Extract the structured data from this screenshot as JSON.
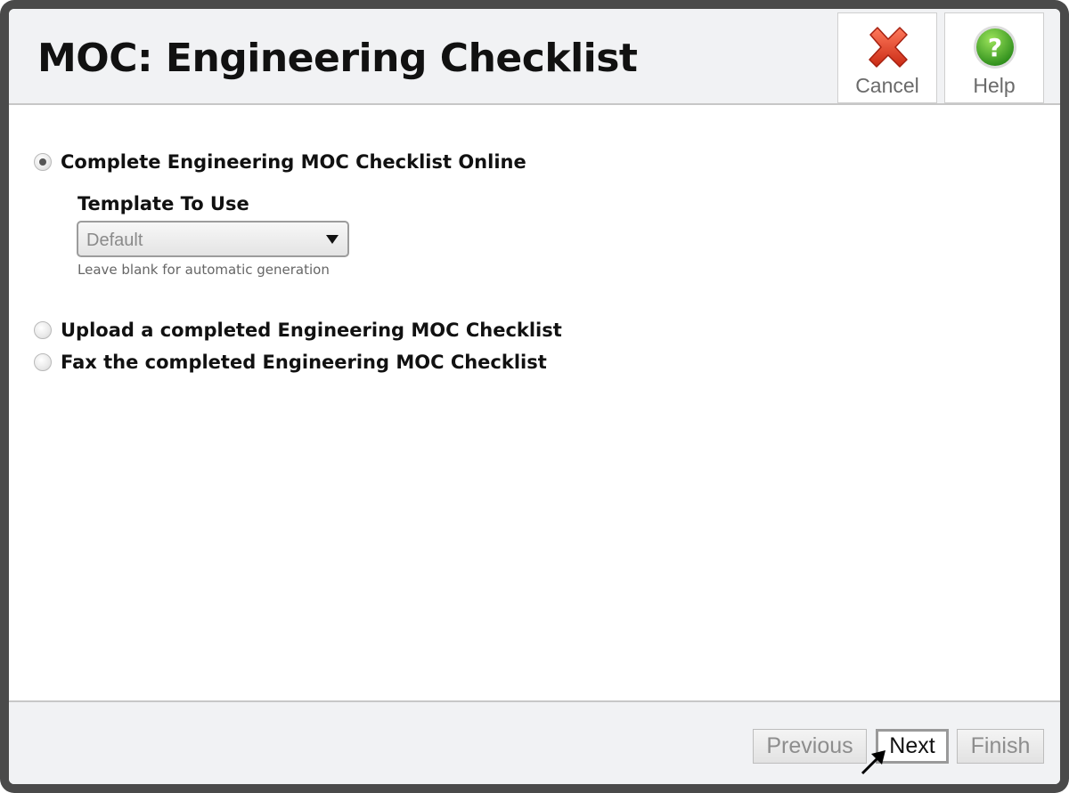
{
  "dialog": {
    "title": "MOC: Engineering Checklist"
  },
  "header_buttons": {
    "cancel_label": "Cancel",
    "cancel_icon": "red-x-icon",
    "help_label": "Help",
    "help_icon": "green-question-icon"
  },
  "options": [
    {
      "label": "Complete Engineering MOC Checklist Online",
      "selected": true
    },
    {
      "label": "Upload a completed Engineering MOC Checklist",
      "selected": false
    },
    {
      "label": "Fax the completed Engineering MOC Checklist",
      "selected": false
    }
  ],
  "template": {
    "label": "Template To Use",
    "selected_value": "Default",
    "hint": "Leave blank for automatic generation"
  },
  "footer": {
    "previous_label": "Previous",
    "next_label": "Next",
    "finish_label": "Finish"
  },
  "colors": {
    "cancel_red": "#e8422b",
    "help_green": "#3fae2a",
    "frame": "#4a4a4a",
    "panel_bg": "#f1f2f4"
  }
}
